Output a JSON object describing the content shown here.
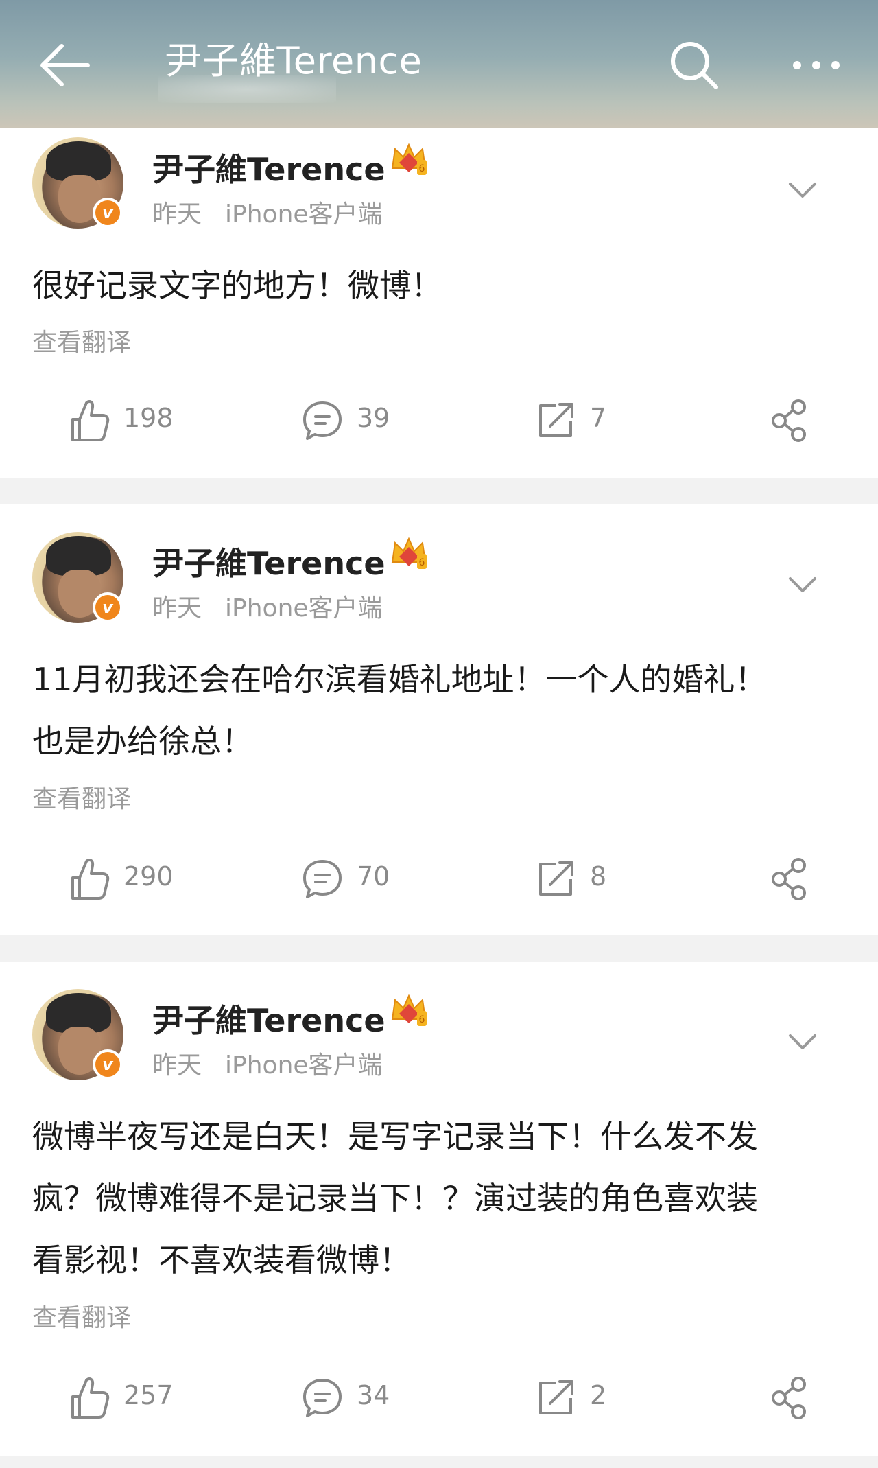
{
  "header": {
    "title": "尹子維Terence",
    "back_icon": "arrow-left-icon",
    "search_icon": "search-icon",
    "more_icon": "more-dots-icon"
  },
  "posts": [
    {
      "username": "尹子維Terence",
      "time": "昨天",
      "source": "iPhone客户端",
      "text_lines": [
        "很好记录文字的地方！微博！"
      ],
      "translate_label": "查看翻译",
      "likes": "198",
      "comments": "39",
      "reposts": "7"
    },
    {
      "username": "尹子維Terence",
      "time": "昨天",
      "source": "iPhone客户端",
      "text_lines": [
        "11月初我还会在哈尔滨看婚礼地址！一个人的婚礼！",
        "也是办给徐总！"
      ],
      "translate_label": "查看翻译",
      "likes": "290",
      "comments": "70",
      "reposts": "8"
    },
    {
      "username": "尹子維Terence",
      "time": "昨天",
      "source": "iPhone客户端",
      "text_lines": [
        "微博半夜写还是白天！是写字记录当下！什么发不发",
        "疯？微博难得不是记录当下！？演过装的角色喜欢装",
        "看影视！不喜欢装看微博！"
      ],
      "translate_label": "查看翻译",
      "likes": "257",
      "comments": "34",
      "reposts": "2"
    }
  ],
  "colors": {
    "verified_orange": "#f0861c",
    "crown_gold": "#f5b320",
    "crown_red": "#e0463a",
    "meta_gray": "#9a9a9a",
    "divider_gray": "#f2f2f2"
  }
}
